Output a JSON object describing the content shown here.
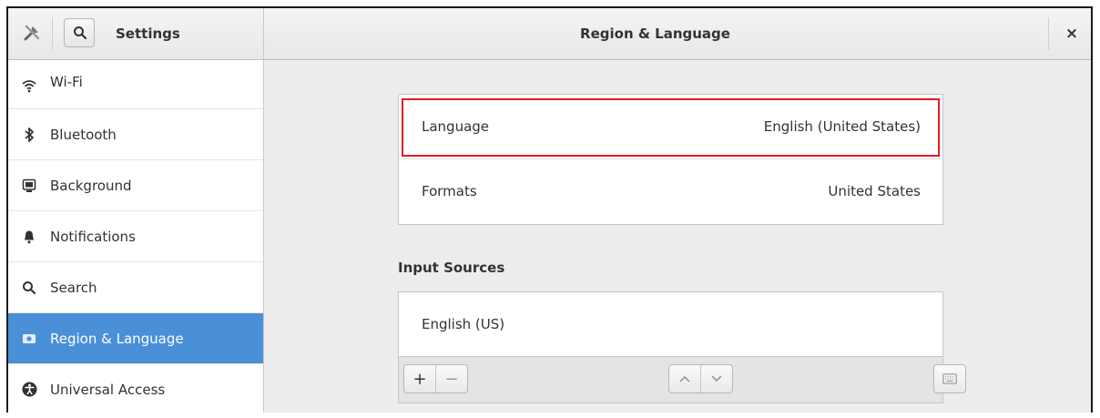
{
  "header": {
    "app_title": "Settings",
    "page_title": "Region & Language",
    "close_glyph": "×"
  },
  "sidebar": {
    "items": [
      {
        "label": "Wi-Fi",
        "icon": "wifi-icon"
      },
      {
        "label": "Bluetooth",
        "icon": "bluetooth-icon"
      },
      {
        "label": "Background",
        "icon": "background-icon"
      },
      {
        "label": "Notifications",
        "icon": "bell-icon"
      },
      {
        "label": "Search",
        "icon": "search-icon"
      },
      {
        "label": "Region & Language",
        "icon": "region-icon",
        "active": true
      },
      {
        "label": "Universal Access",
        "icon": "accessibility-icon"
      }
    ]
  },
  "language_panel": {
    "rows": [
      {
        "label": "Language",
        "value": "English (United States)"
      },
      {
        "label": "Formats",
        "value": "United States"
      }
    ]
  },
  "input_sources": {
    "title": "Input Sources",
    "items": [
      "English (US)"
    ],
    "toolbar": {
      "add": "+",
      "remove": "−"
    }
  },
  "colors": {
    "accent": "#4a90d9",
    "highlight_border": "#e01b24"
  }
}
